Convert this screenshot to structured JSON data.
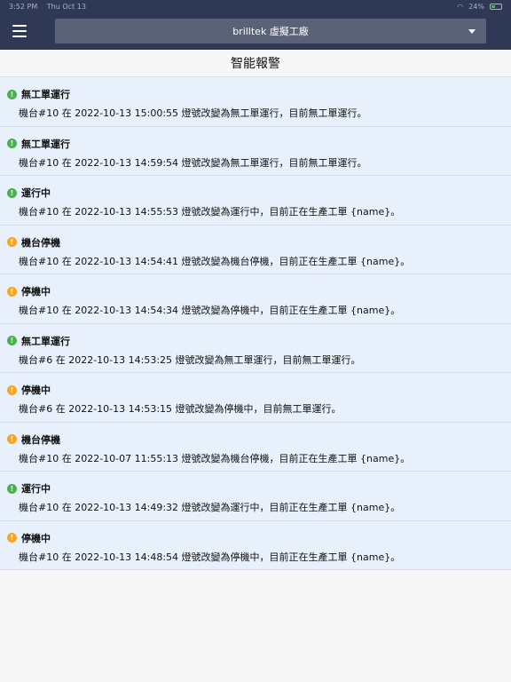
{
  "statusbar": {
    "time": "3:52 PM",
    "date": "Thu Oct 13",
    "battery": "24%"
  },
  "header": {
    "site_name": "brilltek 虛擬工廠"
  },
  "page": {
    "title": "智能報警"
  },
  "colors": {
    "green": "#4caf50",
    "orange": "#f5a623",
    "nav": "#2f3955"
  },
  "alerts": [
    {
      "status": "green",
      "icon": "info-green-icon",
      "title": "無工單運行",
      "message": "機台#10 在 2022-10-13 15:00:55 燈號改變為無工單運行，目前無工單運行。"
    },
    {
      "status": "green",
      "icon": "info-green-icon",
      "title": "無工單運行",
      "message": "機台#10 在 2022-10-13 14:59:54 燈號改變為無工單運行，目前無工單運行。"
    },
    {
      "status": "green",
      "icon": "info-green-icon",
      "title": "運行中",
      "message": "機台#10 在 2022-10-13 14:55:53 燈號改變為運行中，目前正在生產工單 {name}。"
    },
    {
      "status": "orange",
      "icon": "info-orange-icon",
      "title": "機台停機",
      "message": "機台#10 在 2022-10-13 14:54:41 燈號改變為機台停機，目前正在生產工單 {name}。"
    },
    {
      "status": "orange",
      "icon": "info-orange-icon",
      "title": "停機中",
      "message": "機台#10 在 2022-10-13 14:54:34 燈號改變為停機中，目前正在生產工單 {name}。"
    },
    {
      "status": "green",
      "icon": "info-green-icon",
      "title": "無工單運行",
      "message": "機台#6 在 2022-10-13 14:53:25 燈號改變為無工單運行，目前無工單運行。"
    },
    {
      "status": "orange",
      "icon": "info-orange-icon",
      "title": "停機中",
      "message": "機台#6 在 2022-10-13 14:53:15 燈號改變為停機中，目前無工單運行。"
    },
    {
      "status": "orange",
      "icon": "info-orange-icon",
      "title": "機台停機",
      "message": "機台#10 在 2022-10-07 11:55:13 燈號改變為機台停機，目前正在生產工單 {name}。"
    },
    {
      "status": "green",
      "icon": "info-green-icon",
      "title": "運行中",
      "message": "機台#10 在 2022-10-13 14:49:32 燈號改變為運行中，目前正在生產工單 {name}。"
    },
    {
      "status": "orange",
      "icon": "info-orange-icon",
      "title": "停機中",
      "message": "機台#10 在 2022-10-13 14:48:54 燈號改變為停機中，目前正在生產工單 {name}。"
    }
  ]
}
